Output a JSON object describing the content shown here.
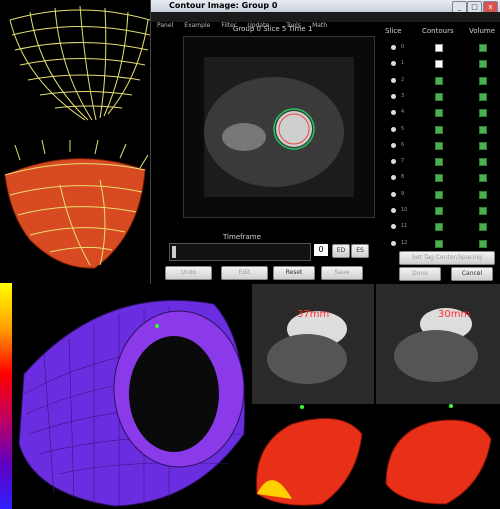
{
  "window": {
    "title": "Contour Image: Group 0",
    "menu": [
      "Panel",
      "Example",
      "Filter",
      "Update",
      "",
      "Tools",
      "Math"
    ],
    "image_label": "Group 0 Slice 5 Time 1"
  },
  "table": {
    "headers": [
      "Slice",
      "Contours",
      "Volume"
    ],
    "rows": [
      {
        "slice": "0",
        "contours": false,
        "volume": true
      },
      {
        "slice": "1",
        "contours": false,
        "volume": true
      },
      {
        "slice": "2",
        "contours": true,
        "volume": true
      },
      {
        "slice": "3",
        "contours": true,
        "volume": true
      },
      {
        "slice": "4",
        "contours": true,
        "volume": true
      },
      {
        "slice": "5",
        "contours": true,
        "volume": true
      },
      {
        "slice": "6",
        "contours": true,
        "volume": true
      },
      {
        "slice": "7",
        "contours": true,
        "volume": true
      },
      {
        "slice": "8",
        "contours": true,
        "volume": true
      },
      {
        "slice": "9",
        "contours": true,
        "volume": true
      },
      {
        "slice": "10",
        "contours": true,
        "volume": true
      },
      {
        "slice": "11",
        "contours": true,
        "volume": true
      },
      {
        "slice": "12",
        "contours": true,
        "volume": true
      }
    ]
  },
  "timeframe": {
    "label": "Timeframe",
    "value": "0",
    "ed": "ED",
    "es": "ES"
  },
  "buttons": {
    "undo": "Undo",
    "edit": "Edit",
    "reset": "Reset",
    "save": "Save",
    "set_tag": "Set Tag Center/Spacing",
    "done": "Done",
    "cancel": "Cancel"
  },
  "annotations": {
    "left_mm": "37mm",
    "right_mm": "30mm"
  },
  "colors": {
    "mesh": "#e8e070",
    "surface": "#e04020",
    "purple": "#7030d0"
  }
}
